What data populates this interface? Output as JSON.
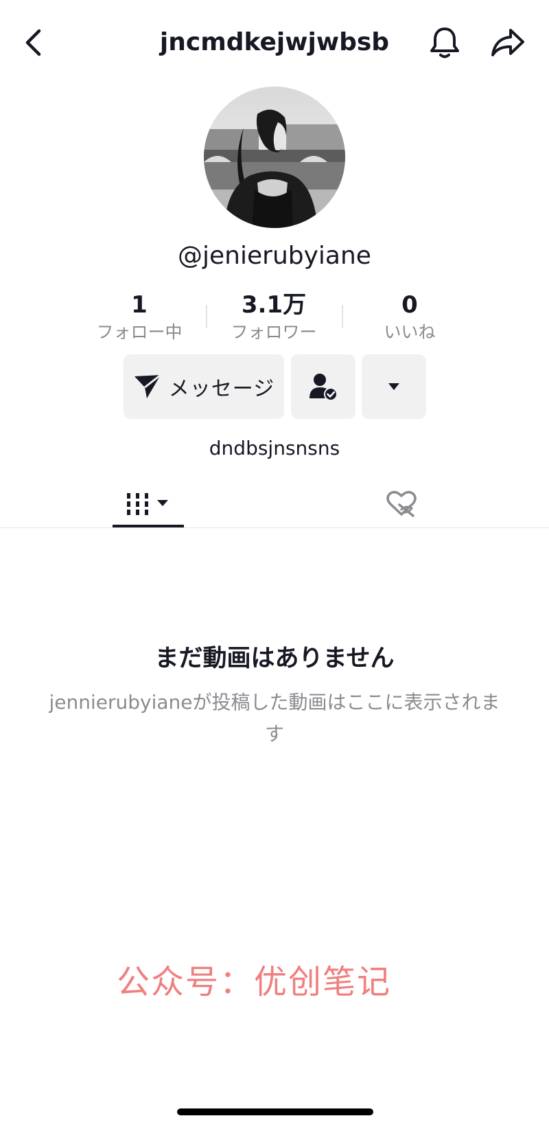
{
  "header": {
    "title": "jncmdkejwjwbsb",
    "back_icon": "chevron-left-icon",
    "bell_icon": "bell-icon",
    "share_icon": "share-icon"
  },
  "profile": {
    "handle": "@jenierubyiane",
    "bio": "dndbsjnsnsns"
  },
  "stats": [
    {
      "value": "1",
      "label": "フォロー中"
    },
    {
      "value": "3.1万",
      "label": "フォロワー"
    },
    {
      "value": "0",
      "label": "いいね"
    }
  ],
  "actions": {
    "message_label": "メッセージ",
    "message_icon": "send-icon",
    "friend_icon": "user-check-icon",
    "more_icon": "caret-down-icon"
  },
  "tabs": {
    "videos_icon": "grid-icon",
    "liked_icon": "heart-hidden-icon"
  },
  "empty_state": {
    "title": "まだ動画はありません",
    "subtitle": "jennierubyianeが投稿した動画はここに表示されます"
  },
  "watermark": "公众号：优创笔记",
  "colors": {
    "text": "#161823",
    "muted": "#8a8b91",
    "button_bg": "#f1f1f2",
    "watermark": "#f07f7f"
  }
}
